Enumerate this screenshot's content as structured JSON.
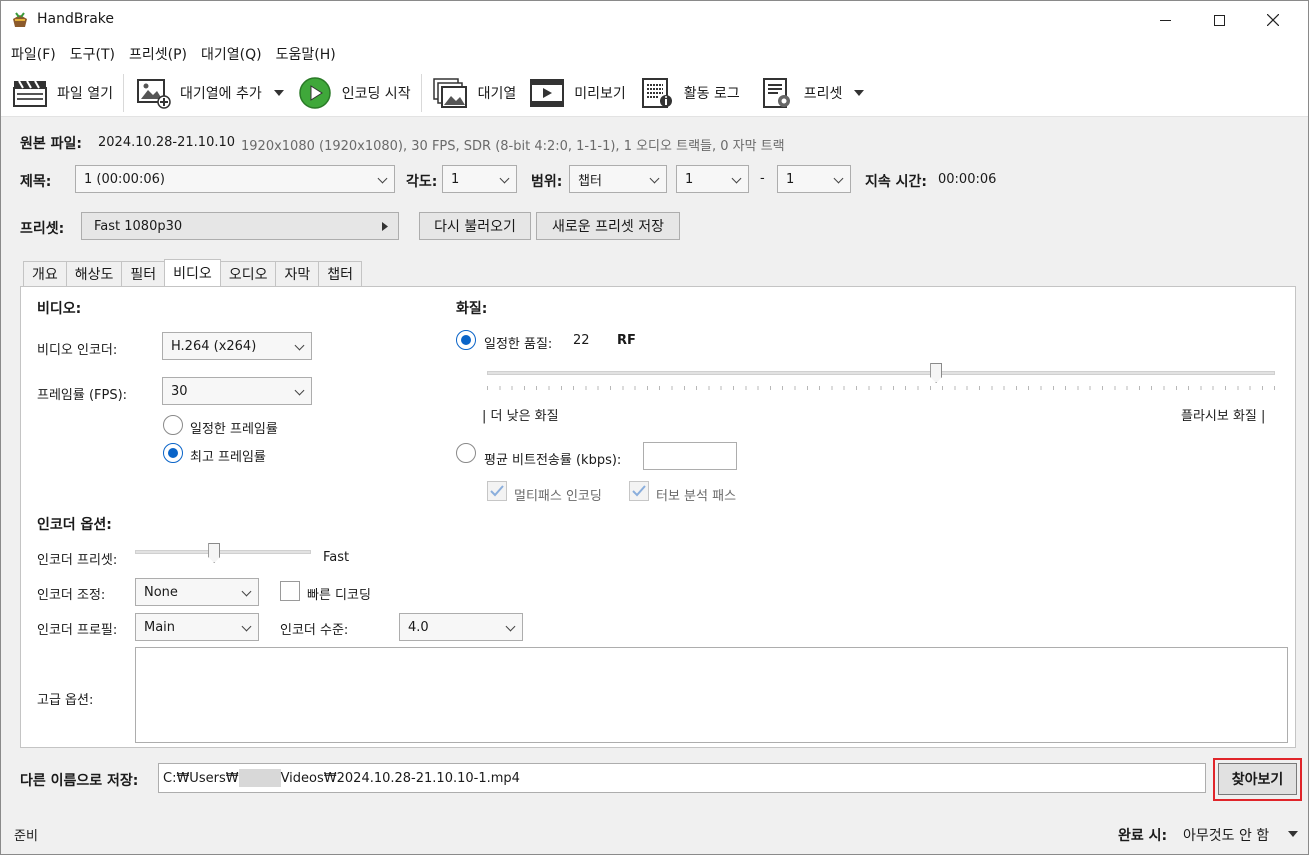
{
  "window": {
    "title": "HandBrake",
    "controls": [
      "minimize-icon",
      "maximize-icon",
      "close-icon"
    ]
  },
  "menu": [
    "파일(F)",
    "도구(T)",
    "프리셋(P)",
    "대기열(Q)",
    "도움말(H)"
  ],
  "toolbar": {
    "open": "파일 열기",
    "add_queue": "대기열에 추가",
    "start": "인코딩 시작",
    "queue": "대기열",
    "preview": "미리보기",
    "activity": "활동 로그",
    "presets": "프리셋"
  },
  "source": {
    "label": "원본 파일:",
    "name": "2024.10.28-21.10.10",
    "info": "1920x1080 (1920x1080), 30 FPS, SDR (8-bit 4:2:0, 1-1-1), 1 오디오 트랙들, 0 자막 트랙"
  },
  "title_row": {
    "title_label": "제목:",
    "title_value": "1  (00:00:06)",
    "angle_label": "각도:",
    "angle_value": "1",
    "range_label": "범위:",
    "range_type": "챕터",
    "range_start": "1",
    "range_dash": "-",
    "range_end": "1",
    "duration_label": "지속 시간:",
    "duration_value": "00:00:06"
  },
  "preset_row": {
    "label": "프리셋:",
    "value": "Fast 1080p30",
    "reload": "다시 불러오기",
    "save_new": "새로운 프리셋 저장"
  },
  "tabs": [
    {
      "label": "개요",
      "active": false
    },
    {
      "label": "해상도",
      "active": false
    },
    {
      "label": "필터",
      "active": false
    },
    {
      "label": "비디오",
      "active": true
    },
    {
      "label": "오디오",
      "active": false
    },
    {
      "label": "자막",
      "active": false
    },
    {
      "label": "챕터",
      "active": false
    }
  ],
  "video": {
    "section": "비디오:",
    "encoder_label": "비디오 인코더:",
    "encoder_value": "H.264 (x264)",
    "fps_label": "프레임률 (FPS):",
    "fps_value": "30",
    "constant_fr": "일정한 프레임률",
    "peak_fr": "최고 프레임률",
    "peak_selected": true
  },
  "quality": {
    "section": "화질:",
    "cq_label": "일정한 품질:",
    "cq_value": "22",
    "cq_unit": "RF",
    "cq_selected": true,
    "slider_fraction": 0.57,
    "low": "| 더 낮은 화질",
    "high": "플라시보 화질 |",
    "abr_label": "평균 비트전송률 (kbps):",
    "abr_value": "",
    "multipass": "멀티패스 인코딩",
    "turbo": "터보 분석 패스"
  },
  "encoder_opts": {
    "section": "인코더 옵션:",
    "preset_label": "인코더 프리셋:",
    "preset_value": "Fast",
    "preset_fraction": 0.45,
    "tune_label": "인코더 조정:",
    "tune_value": "None",
    "fast_decode": "빠른 디코딩",
    "profile_label": "인코더 프로필:",
    "profile_value": "Main",
    "level_label": "인코더 수준:",
    "level_value": "4.0",
    "advanced_label": "고급 옵션:",
    "advanced_value": ""
  },
  "save": {
    "label": "다른 이름으로 저장:",
    "path_a": "C:₩Users₩",
    "path_b": "Videos₩2024.10.28-21.10.10-1.mp4",
    "browse": "찾아보기"
  },
  "status": {
    "left": "준비",
    "when_done_label": "완료 시:",
    "when_done_value": "아무것도 안 함"
  },
  "colors": {
    "accent": "#0a64c8",
    "highlight_box": "#e0252a",
    "start_green": "#3fa83a"
  }
}
